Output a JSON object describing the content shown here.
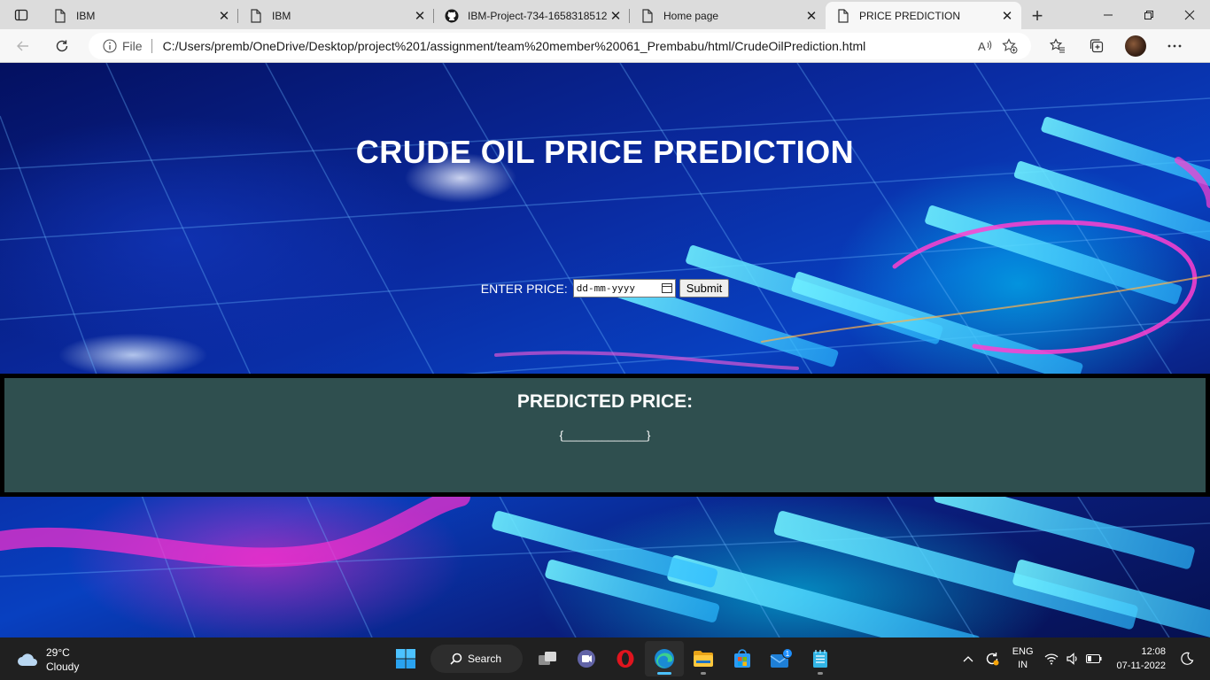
{
  "browser": {
    "tabs": [
      {
        "label": "IBM",
        "icon": "page-icon",
        "active": false
      },
      {
        "label": "IBM",
        "icon": "page-icon",
        "active": false
      },
      {
        "label": "IBM-Project-734-1658318512",
        "icon": "github-icon",
        "active": false
      },
      {
        "label": "Home page",
        "icon": "page-icon",
        "active": false
      },
      {
        "label": "PRICE PREDICTION",
        "icon": "page-icon",
        "active": true
      }
    ],
    "address": {
      "scheme_label": "File",
      "url": "C:/Users/premb/OneDrive/Desktop/project%201/assignment/team%20member%20061_Prembabu/html/CrudeOilPrediction.html"
    }
  },
  "page": {
    "title": "CRUDE OIL PRICE PREDICTION",
    "form": {
      "label": "ENTER PRICE:",
      "date_placeholder": "dd-mm-yyyy",
      "submit_label": "Submit"
    },
    "result": {
      "title": "PREDICTED PRICE:",
      "value": "{_____________}"
    }
  },
  "taskbar": {
    "weather": {
      "temp": "29°C",
      "condition": "Cloudy"
    },
    "search_label": "Search",
    "mail_badge": "1",
    "language": {
      "line1": "ENG",
      "line2": "IN"
    },
    "clock": {
      "time": "12:08",
      "date": "07-11-2022"
    }
  }
}
